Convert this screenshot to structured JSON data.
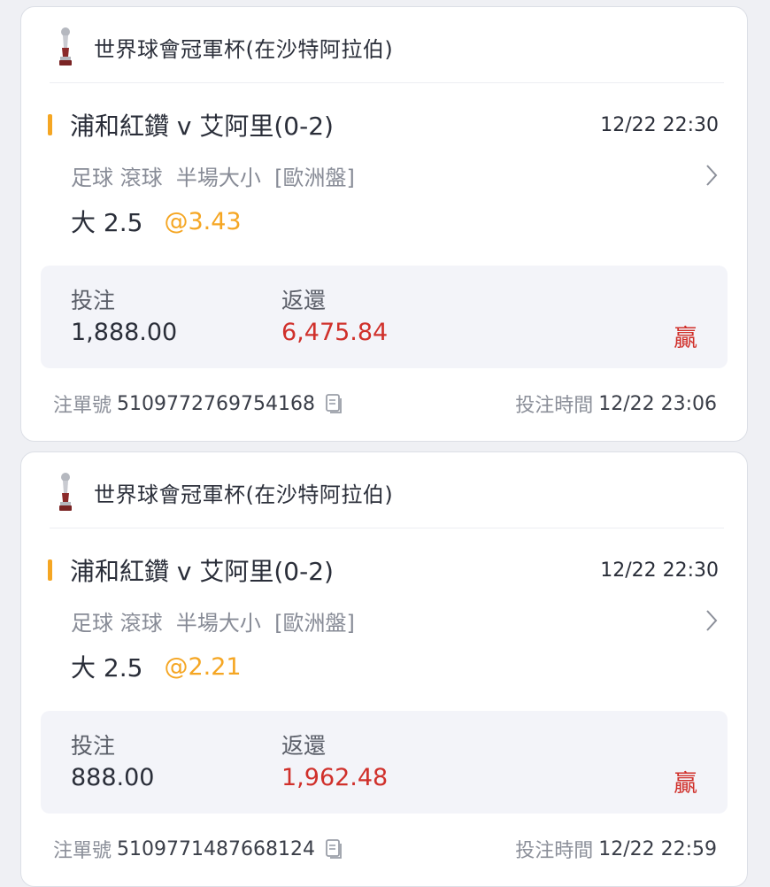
{
  "bets": [
    {
      "league": "世界球會冠軍杯(在沙特阿拉伯)",
      "match": "浦和紅鑽 v 艾阿里(0-2)",
      "match_time": "12/22 22:30",
      "market": "足球 滾球  半場大小  [歐洲盤]",
      "pick": "大 2.5",
      "odds": "@3.43",
      "stake_label": "投注",
      "stake": "1,888.00",
      "return_label": "返還",
      "return": "6,475.84",
      "result": "贏",
      "order_label": "注單號",
      "order_no": "5109772769754168",
      "bet_time_label": "投注時間",
      "bet_time": "12/22 23:06"
    },
    {
      "league": "世界球會冠軍杯(在沙特阿拉伯)",
      "match": "浦和紅鑽 v 艾阿里(0-2)",
      "match_time": "12/22 22:30",
      "market": "足球 滾球  半場大小  [歐洲盤]",
      "pick": "大 2.5",
      "odds": "@2.21",
      "stake_label": "投注",
      "stake": "888.00",
      "return_label": "返還",
      "return": "1,962.48",
      "result": "贏",
      "order_label": "注單號",
      "order_no": "5109771487668124",
      "bet_time_label": "投注時間",
      "bet_time": "12/22 22:59"
    }
  ],
  "colors": {
    "accent": "#f5a623",
    "win": "#d0302b",
    "background": "#eff0f4"
  },
  "icons": {
    "league": "trophy-icon",
    "detail": "chevron-right-icon",
    "copy": "copy-icon"
  }
}
